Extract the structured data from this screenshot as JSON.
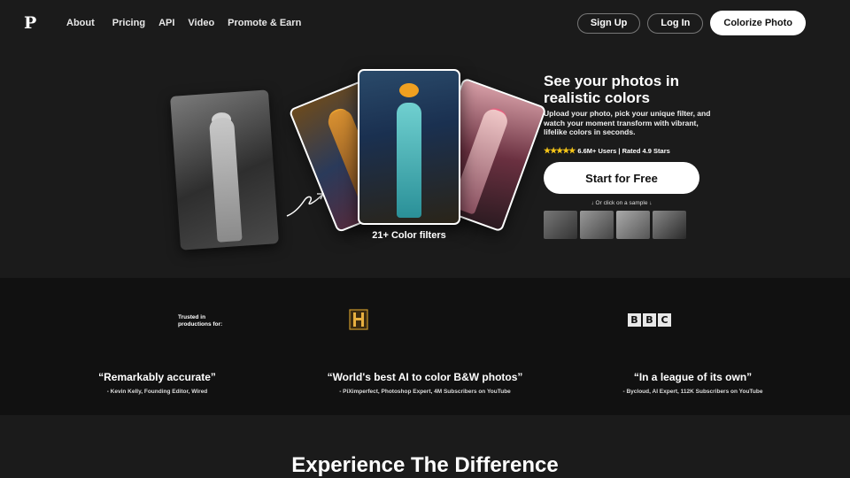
{
  "nav": {
    "logo": "P",
    "links": [
      "About",
      "Pricing",
      "API",
      "Video",
      "Promote & Earn"
    ],
    "signup": "Sign Up",
    "login": "Log In",
    "colorize": "Colorize Photo"
  },
  "hero": {
    "title": "See your photos in realistic colors",
    "description": "Upload your photo, pick your unique filter, and watch your moment transform with vibrant, lifelike colors in seconds.",
    "stars": "★★★★★",
    "rating_text": "6.6M+ Users | Rated 4.9 Stars",
    "cta": "Start for Free",
    "sample_hint": "↓ Or click on a sample ↓",
    "filters_label": "21+ Color filters"
  },
  "trust": {
    "trusted_text": "Trusted in productions for:",
    "bbc_letters": [
      "B",
      "B",
      "C"
    ],
    "quotes": [
      {
        "quote": "“Remarkably accurate”",
        "author": "- Kevin Kelly, Founding Editor, Wired"
      },
      {
        "quote": "“World's best AI to color B&W photos”",
        "author": "- PiXimperfect, Photoshop Expert, 4M Subscribers on YouTube"
      },
      {
        "quote": "“In a league of its own”",
        "author": "- Bycloud, AI Expert, 112K Subscribers on YouTube"
      }
    ]
  },
  "section2": {
    "title": "Experience The Difference"
  },
  "colors": {
    "background": "#1b1b1b",
    "band": "#111111",
    "star": "#f5c518",
    "button": "#ffffff"
  }
}
